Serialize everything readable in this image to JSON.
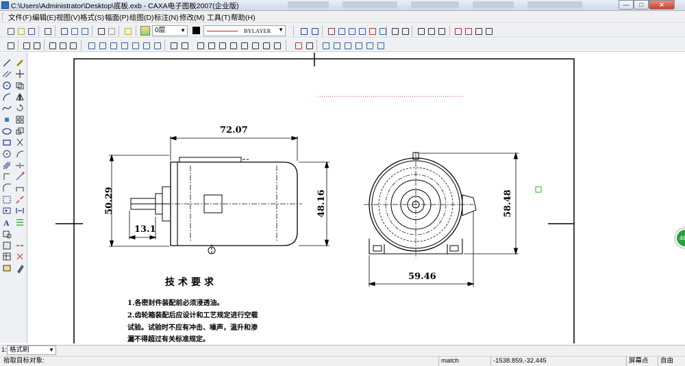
{
  "window": {
    "title": "C:\\Users\\Administrator\\Desktop\\底板.exb - CAXA电子图板2007(企业版)",
    "minimize": "—",
    "maximize": "□",
    "close": "✕"
  },
  "menu": [
    "文件(F)",
    "编辑(E)",
    "视图(V)",
    "格式(S)",
    "幅面(P)",
    "绘图(D)",
    "标注(N)",
    "修改(M)",
    "工具(T)",
    "帮助(H)"
  ],
  "toolbar": {
    "layer_value": "0层",
    "linetype_value": "BYLAYER",
    "line_color": "#ff0000"
  },
  "drawing": {
    "dimensions": {
      "top_width": "72.07",
      "left_height": "50.29",
      "shaft_length": "13.1",
      "body_height": "48.16",
      "right_height": "58.48",
      "bottom_width": "59.46"
    },
    "tech_requirements": {
      "title": "技术要求",
      "lines": [
        "1.各密封件装配前必须浸透油。",
        "2.齿轮箱装配后应设计和工艺规定进行空载",
        "试验。试验时不应有冲击、噪声，温升和渗",
        "漏不得超过有关标准规定。"
      ]
    }
  },
  "command": {
    "number": "1:",
    "format_brush": "格式刷"
  },
  "status": {
    "prompt": "拾取目标对象:",
    "mode": "match",
    "coordinates": "-1538.859,-32.445",
    "snap": "屏幕点",
    "free": "自由"
  },
  "badge": {
    "value": "46"
  }
}
